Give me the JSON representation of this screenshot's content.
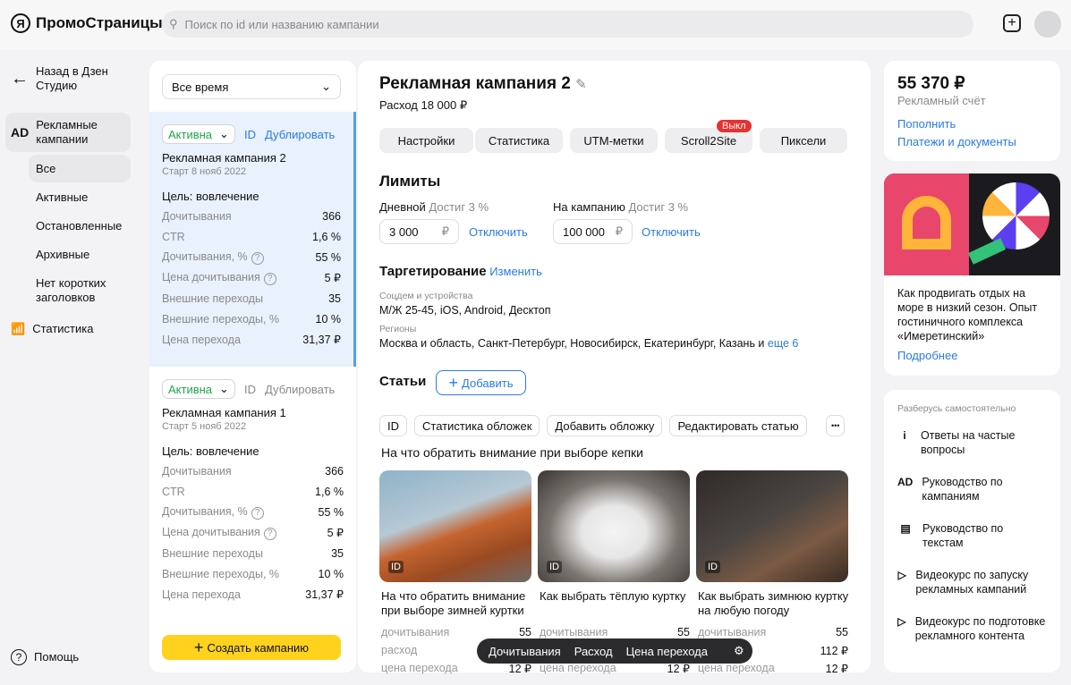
{
  "header": {
    "logo": "ПромоСтраницы",
    "logo_letter": "Я",
    "search_placeholder": "Поиск по id или названию кампании"
  },
  "sidebar": {
    "back": "Назад в Дзен Студию",
    "campaigns": "Рекламные кампании",
    "campaigns_icon": "AD",
    "sub": [
      "Все",
      "Активные",
      "Остановленные",
      "Архивные",
      "Нет коротких заголовков"
    ],
    "stats": "Статистика",
    "help": "Помощь"
  },
  "list": {
    "period": "Все время",
    "create": "Создать кампанию",
    "campaigns": [
      {
        "status": "Активна",
        "id": "ID",
        "duplicate": "Дублировать",
        "name": "Рекламная кампания 2",
        "start": "Старт 8 нояб 2022",
        "goal": "Цель: вовлечение",
        "stats": [
          [
            "Дочитывания",
            "366"
          ],
          [
            "CTR",
            "1,6 %"
          ],
          [
            "Дочитывания, %",
            "55 %"
          ],
          [
            "Цена дочитывания",
            "5 ₽"
          ],
          [
            "Внешние переходы",
            "35"
          ],
          [
            "Внешние переходы, %",
            "10 %"
          ],
          [
            "Цена перехода",
            "31,37 ₽"
          ]
        ]
      },
      {
        "status": "Активна",
        "id": "ID",
        "duplicate": "Дублировать",
        "name": "Рекламная кампания 1",
        "start": "Старт 5 нояб 2022",
        "goal": "Цель: вовлечение",
        "stats": [
          [
            "Дочитывания",
            "366"
          ],
          [
            "CTR",
            "1,6 %"
          ],
          [
            "Дочитывания, %",
            "55 %"
          ],
          [
            "Цена дочитывания",
            "5 ₽"
          ],
          [
            "Внешние переходы",
            "35"
          ],
          [
            "Внешние переходы, %",
            "10 %"
          ],
          [
            "Цена перехода",
            "31,37 ₽"
          ]
        ]
      }
    ]
  },
  "main": {
    "title": "Рекламная кампания 2",
    "spend": "Расход 18 000 ₽",
    "tabs": [
      "Настройки",
      "Статистика",
      "UTM-метки",
      "Scroll2Site",
      "Пиксели"
    ],
    "tab_badge": "Выкл",
    "limits": {
      "title": "Лимиты",
      "daily": "Дневной",
      "daily_reach": "Достиг 3 %",
      "daily_value": "3 000",
      "campaign": "На кампанию",
      "campaign_reach": "Достиг 3 %",
      "campaign_value": "100 000",
      "currency": "₽",
      "disable": "Отключить"
    },
    "targeting": {
      "title": "Таргетирование",
      "edit": "Изменить",
      "devices_label": "Соцдем и устройства",
      "devices": "М/Ж 25-45, iOS, Android, Десктоп",
      "regions_label": "Регионы",
      "regions": "Москва и область, Санкт-Петербург, Новосибирск, Екатеринбург, Казань и",
      "more": "еще 6"
    },
    "articles": {
      "title": "Статьи",
      "add": "Добавить",
      "chips": [
        "ID",
        "Статистика обложек",
        "Добавить обложку",
        "Редактировать статью"
      ],
      "more": "•••",
      "heading": "На что обратить внимание при выборе кепки",
      "items": [
        {
          "id": "ID",
          "title": "На что обратить внимание при выборе зимней куртки",
          "metrics": [
            [
              "дочитывания",
              "55"
            ],
            [
              "расход",
              "112 ₽"
            ],
            [
              "цена перехода",
              "12 ₽"
            ]
          ]
        },
        {
          "id": "ID",
          "title": "Как выбрать тёплую куртку",
          "metrics": [
            [
              "дочитывания",
              "55"
            ],
            [
              "расход",
              "112 ₽"
            ],
            [
              "цена перехода",
              "12 ₽"
            ]
          ]
        },
        {
          "id": "ID",
          "title": "Как выбрать зимнюю куртку на любую погоду",
          "metrics": [
            [
              "дочитывания",
              "55"
            ],
            [
              "расход",
              "112 ₽"
            ],
            [
              "цена перехода",
              "12 ₽"
            ]
          ]
        }
      ]
    },
    "floatbar": [
      "Дочитывания",
      "Расход",
      "Цена перехода"
    ]
  },
  "right": {
    "balance": "55 370 ₽",
    "balance_label": "Рекламный счёт",
    "topup": "Пополнить",
    "payments": "Платежи и документы",
    "promo_text": "Как продвигать отдых на море в низкий сезон. Опыт гостиничного комплекса «Имеретинский»",
    "promo_link": "Подробнее",
    "help_title": "Разберусь самостоятельно",
    "help": [
      {
        "icon": "i",
        "text": "Ответы на частые вопросы"
      },
      {
        "icon": "AD",
        "text": "Руководство по кампаниям"
      },
      {
        "icon": "▤",
        "text": "Руководство по текстам"
      },
      {
        "icon": "▷",
        "text": "Видеокурс по запуску рекламных кампаний"
      },
      {
        "icon": "▷",
        "text": "Видеокурс по подготовке рекламного контента"
      }
    ]
  }
}
